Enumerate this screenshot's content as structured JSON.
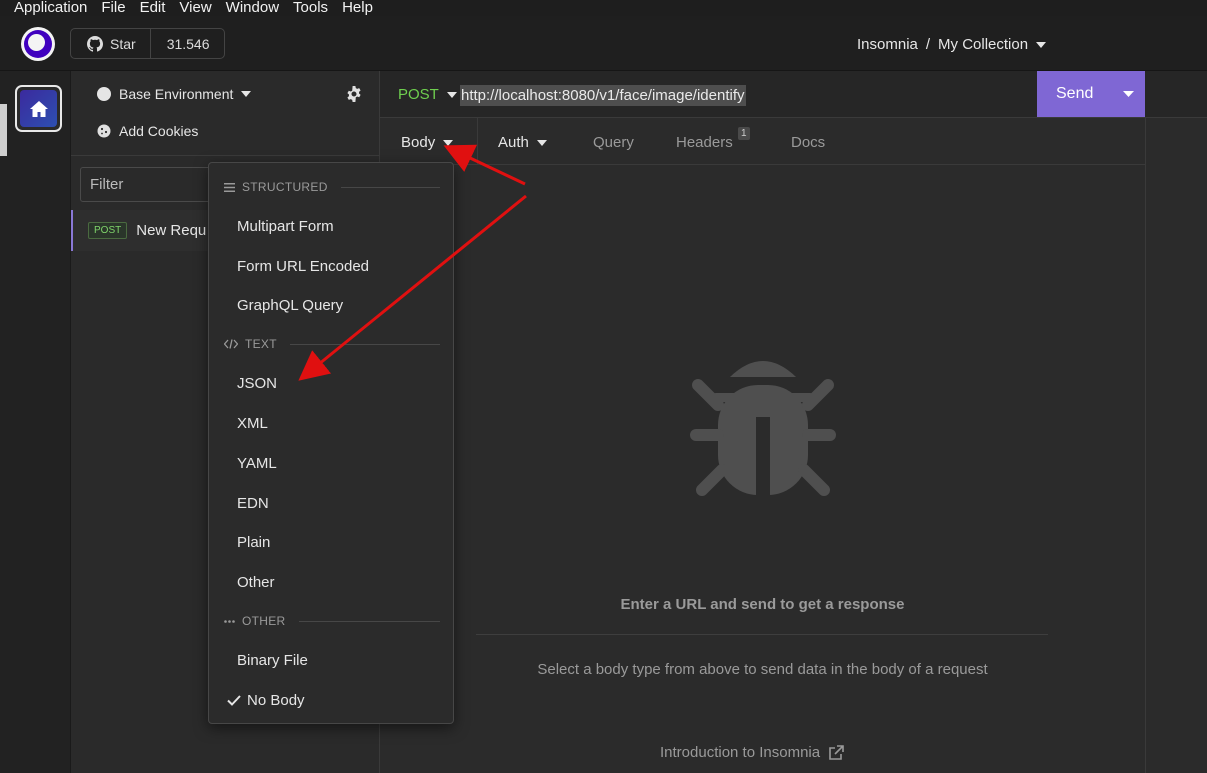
{
  "menubar": [
    "Application",
    "File",
    "Edit",
    "View",
    "Window",
    "Tools",
    "Help"
  ],
  "header": {
    "star_label": "Star",
    "star_count": "31.546",
    "breadcrumb_app": "Insomnia",
    "breadcrumb_sep": "/",
    "breadcrumb_collection": "My Collection"
  },
  "sidebar": {
    "environment": "Base Environment",
    "add_cookies": "Add Cookies",
    "filter_placeholder": "Filter",
    "requests": [
      {
        "method": "POST",
        "name": "New Requ"
      }
    ]
  },
  "request": {
    "method": "POST",
    "url": "http://localhost:8080/v1/face/image/identify",
    "send_label": "Send",
    "tabs": {
      "body": "Body",
      "auth": "Auth",
      "query": "Query",
      "headers": "Headers",
      "headers_count": "1",
      "docs": "Docs"
    }
  },
  "body_menu": {
    "structured_header": "STRUCTURED",
    "structured": [
      "Multipart Form",
      "Form URL Encoded",
      "GraphQL Query"
    ],
    "text_header": "TEXT",
    "text": [
      "JSON",
      "XML",
      "YAML",
      "EDN",
      "Plain",
      "Other"
    ],
    "other_header": "OTHER",
    "other": [
      "Binary File",
      "No Body"
    ],
    "selected": "No Body"
  },
  "response": {
    "empty_title": "Enter a URL and send to get a response",
    "empty_hint": "Select a body type from above to send data in the body of a request",
    "intro_link": "Introduction to Insomnia"
  },
  "colors": {
    "accent": "#7f67d4",
    "method_post": "#6fcf4f",
    "annotation_arrow": "#e01010"
  }
}
